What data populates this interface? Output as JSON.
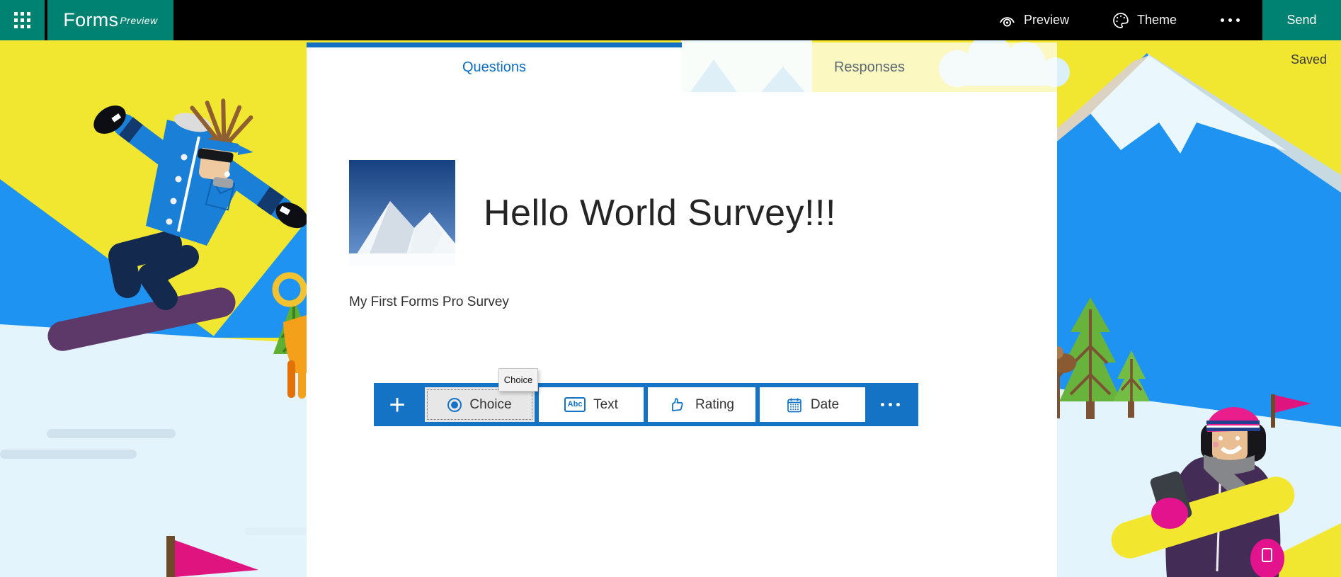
{
  "topbar": {
    "logo": "Forms",
    "logo_sup": "Preview",
    "preview_label": "Preview",
    "theme_label": "Theme",
    "send_label": "Send",
    "saved_status": "Saved"
  },
  "tabs": {
    "questions": "Questions",
    "responses": "Responses"
  },
  "form": {
    "title": "Hello World Survey!!!",
    "description": "My First Forms Pro Survey"
  },
  "toolbar": {
    "add_label": "+",
    "tooltip": "Choice",
    "buttons": [
      {
        "label": "Choice",
        "icon": "radio-icon"
      },
      {
        "label": "Text",
        "icon": "abc-icon",
        "icon_text": "Abc"
      },
      {
        "label": "Rating",
        "icon": "thumbs-up-icon"
      },
      {
        "label": "Date",
        "icon": "calendar-icon"
      }
    ]
  },
  "colors": {
    "brand_teal": "#008272",
    "accent_blue": "#1473C4",
    "tab_active_blue": "#0F6EBE",
    "sky_yellow": "#F1E730",
    "slope_blue": "#1E93F2",
    "snow": "#E3F4FC"
  }
}
